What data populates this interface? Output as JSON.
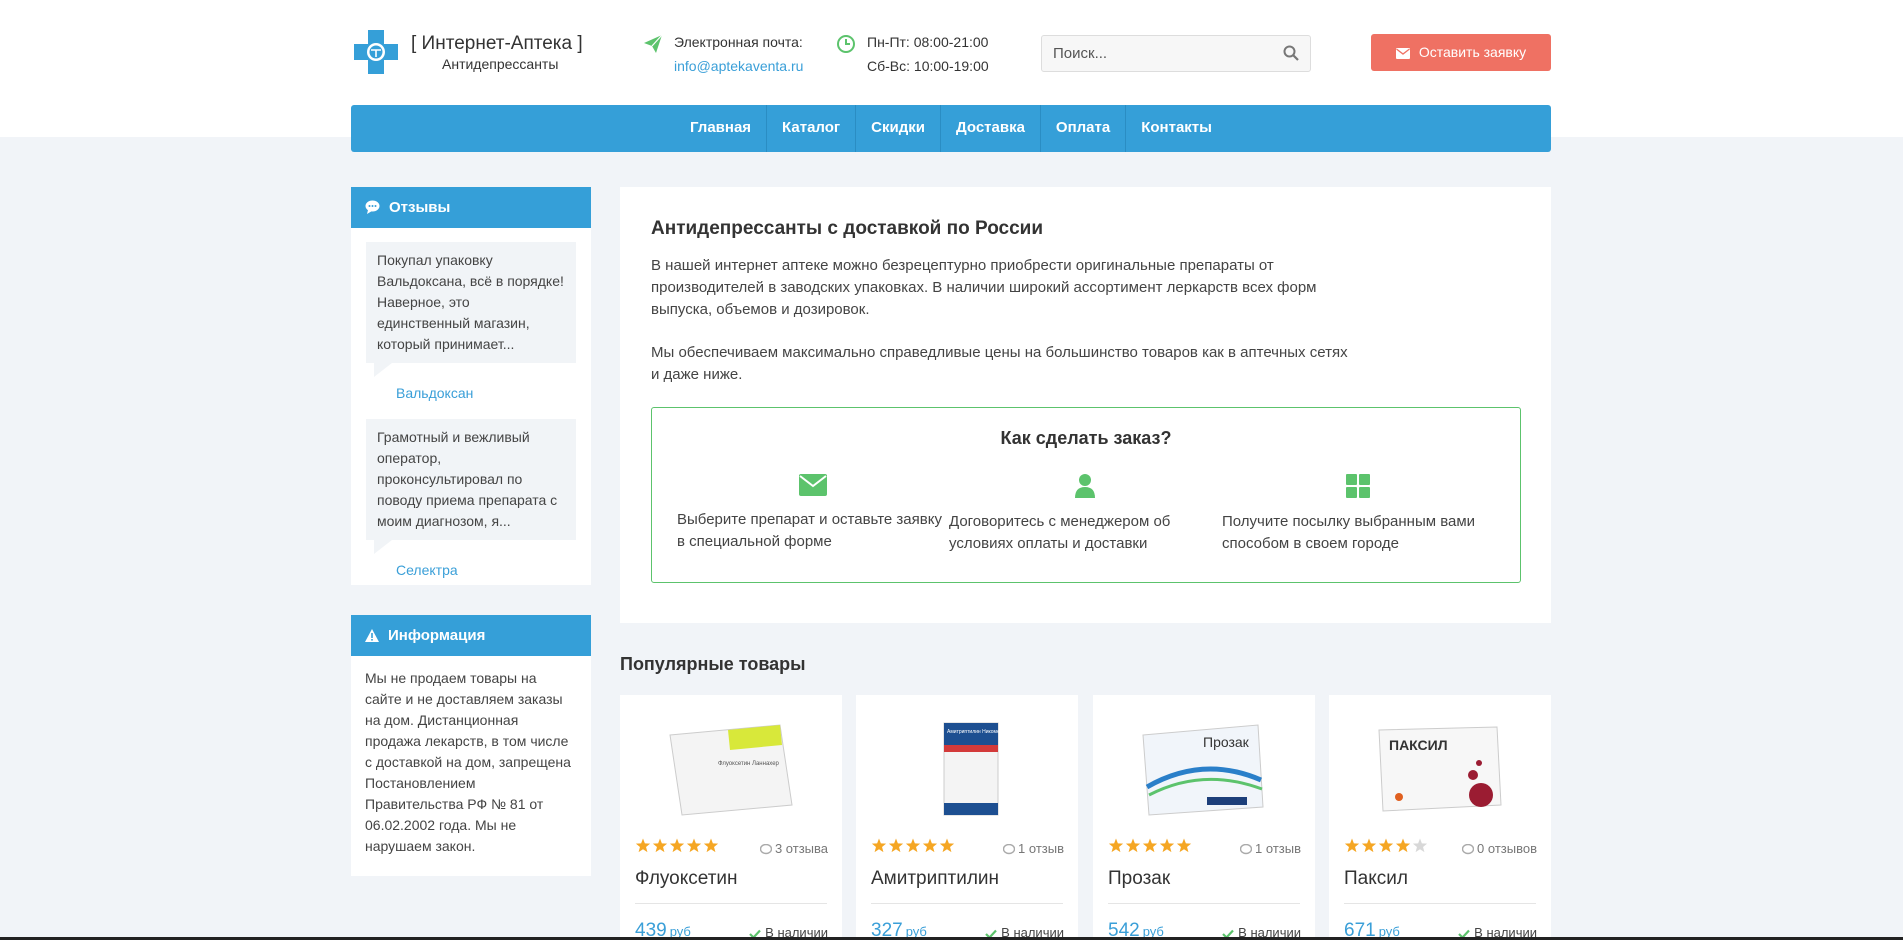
{
  "logo": {
    "title": "[ Интернет-Аптека ]",
    "subtitle": "Антидепрессанты"
  },
  "contacts": {
    "email_label": "Электронная почта:",
    "email": "info@aptekaventa.ru",
    "hours_weekdays": "Пн-Пт: 08:00-21:00",
    "hours_weekend": "Сб-Вс: 10:00-19:00"
  },
  "search": {
    "placeholder": "Поиск..."
  },
  "order_button": "Оставить заявку",
  "nav": [
    "Главная",
    "Каталог",
    "Скидки",
    "Доставка",
    "Оплата",
    "Контакты"
  ],
  "reviews_panel": {
    "title": "Отзывы",
    "items": [
      {
        "text": "Покупал упаковку Вальдоксана, всё в порядке! Наверное, это единственный магазин, который принимает...",
        "product": "Вальдоксан"
      },
      {
        "text": "Грамотный и вежливый оператор, проконсультировал по поводу приема препарата с моим диагнозом, я...",
        "product": "Селектра"
      }
    ]
  },
  "info_panel": {
    "title": "Информация",
    "text": "Мы не продаем товары на сайте и не доставляем заказы на дом. Дистанционная продажа лекарств, в том числе с доставкой на дом, запрещена Постановлением Правительства РФ № 81 от 06.02.2002 года. Мы не нарушаем закон."
  },
  "main": {
    "title": "Антидепрессанты с доставкой по России",
    "para1": "В нашей интернет аптеке можно безрецептурно приобрести оригинальные препараты от производителей в заводских упаковках. В наличии широкий ассортимент леркарств всех форм выпуска, объемов и дозировок.",
    "para2": "Мы обеспечиваем максимально справедливые цены на большинство товаров как в аптечных сетях и даже ниже.",
    "how_title": "Как сделать заказ?",
    "steps": [
      {
        "icon": "envelope-icon",
        "text": "Выберите препарат и оставьте заявку в специальной форме"
      },
      {
        "icon": "user-icon",
        "text": "Договоритесь с менеджером об условиях оплаты и доставки"
      },
      {
        "icon": "grid-icon",
        "text": "Получите посылку выбранным вами способом в своем городе"
      }
    ]
  },
  "popular": {
    "title": "Популярные товары",
    "currency": "руб",
    "stock_label": "В наличии",
    "products": [
      {
        "name": "Флуоксетин",
        "rating": 5,
        "reviews": "3 отзыва",
        "price": "439",
        "box_text": "Флуоксетин Ланнахер",
        "box_color": "#d8e83a"
      },
      {
        "name": "Амитриптилин",
        "rating": 5,
        "reviews": "1 отзыв",
        "price": "327",
        "box_text": "Амитриптилин Никомед",
        "box_color": "#d33a3a"
      },
      {
        "name": "Прозак",
        "rating": 5,
        "reviews": "1 отзыв",
        "price": "542",
        "box_text": "Прозак",
        "box_color": "#2a7fc9"
      },
      {
        "name": "Паксил",
        "rating": 4,
        "reviews": "0 отзывов",
        "price": "671",
        "box_text": "ПАКСИЛ",
        "box_color": "#9b1c32"
      }
    ]
  },
  "colors": {
    "brand_blue": "#359fd8",
    "accent_red": "#ef7163",
    "green": "#5cc36c",
    "star": "#f5a623"
  }
}
